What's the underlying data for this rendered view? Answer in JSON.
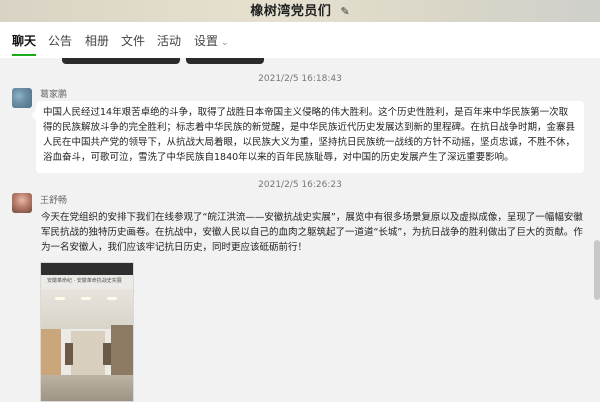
{
  "window": {
    "title": "橡树湾党员们",
    "edit_icon": "edit-icon"
  },
  "tabs": [
    {
      "label": "聊天",
      "active": true
    },
    {
      "label": "公告",
      "active": false
    },
    {
      "label": "相册",
      "active": false
    },
    {
      "label": "文件",
      "active": false
    },
    {
      "label": "活动",
      "active": false
    },
    {
      "label": "设置",
      "active": false,
      "has_dropdown": true
    }
  ],
  "messages": [
    {
      "time": "2021/2/5 16:18:43",
      "sender": "葛家鹏",
      "text": "中国人民经过14年艰苦卓绝的斗争，取得了战胜日本帝国主义侵略的伟大胜利。这个历史性胜利，是百年来中华民族第一次取得的民族解放斗争的完全胜利；标志着中华民族的新觉醒，是中华民族近代历史发展达到新的里程碑。在抗日战争时期，金寨县人民在中国共产党的领导下，从抗战大局着眼，以民族大义为重，坚持抗日民族统一战线的方针不动摇，坚贞忠诚，不胜不休，浴血奋斗，可歌可泣，雪洗了中华民族自1840年以来的百年民族耻辱，对中国的历史发展产生了深远重要影响。"
    },
    {
      "time": "2021/2/5 16:26:23",
      "sender": "王舒畅",
      "text": "今天在党组织的安排下我们在线参观了“皖江洪流——安徽抗战史实展”，展览中有很多场景复原以及虚拟成像，呈现了一幅幅安徽军民抗战的独特历史画卷。在抗战中，安徽人民以自己的血肉之躯筑起了一道道“长城”，为抗日战争的胜利做出了巨大的贡献。作为一名安徽人，我们应该牢记抗日历史，同时更应该砥砺前行！",
      "image_caption": "安徽革命纪 · 安徽革命抗战史实展"
    }
  ],
  "colors": {
    "accent": "#1aad19",
    "bubble": "#ffffff",
    "background": "#f2f2f2"
  }
}
